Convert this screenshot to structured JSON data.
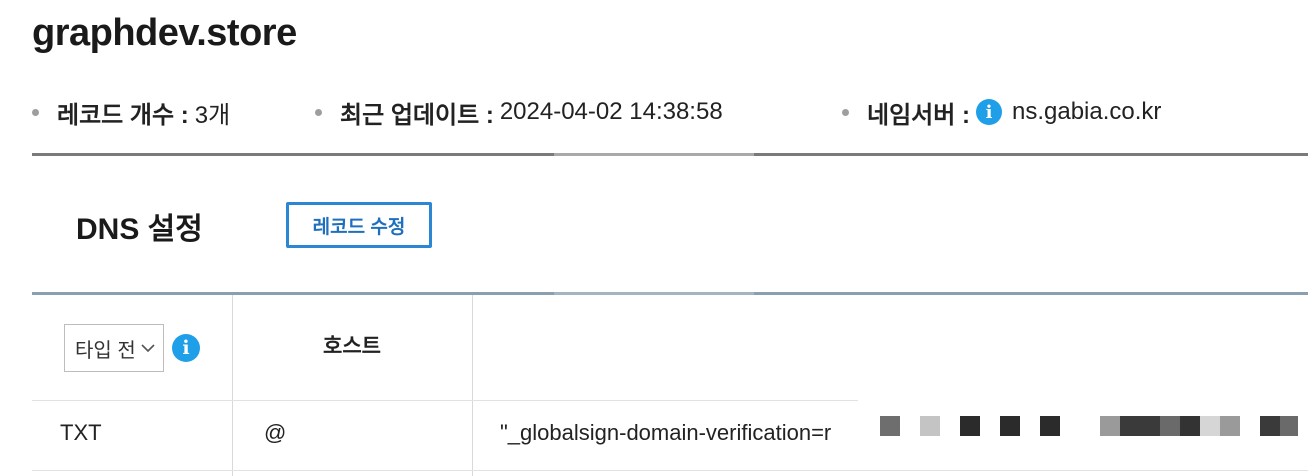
{
  "domain": "graphdev.store",
  "summary": {
    "record_count_label": "레코드 개수 :",
    "record_count_value": "3개",
    "updated_label": "최근 업데이트 :",
    "updated_value": "2024-04-02 14:38:58",
    "nameserver_label": "네임서버 :",
    "nameserver_value": "ns.gabia.co.kr"
  },
  "dns_section": {
    "title": "DNS 설정",
    "edit_button": "레코드 수정"
  },
  "table": {
    "type_filter_value": "타입 전",
    "host_header": "호스트",
    "rows": [
      {
        "type": "TXT",
        "host": "@",
        "value": "\"_globalsign-domain-verification=r"
      }
    ]
  },
  "icons": {
    "info": "info-icon",
    "dropdown": "chevron-down-icon",
    "bullet": "bullet-icon"
  },
  "colors": {
    "accent_blue": "#2b86d3",
    "info_blue": "#1e9fe8"
  }
}
